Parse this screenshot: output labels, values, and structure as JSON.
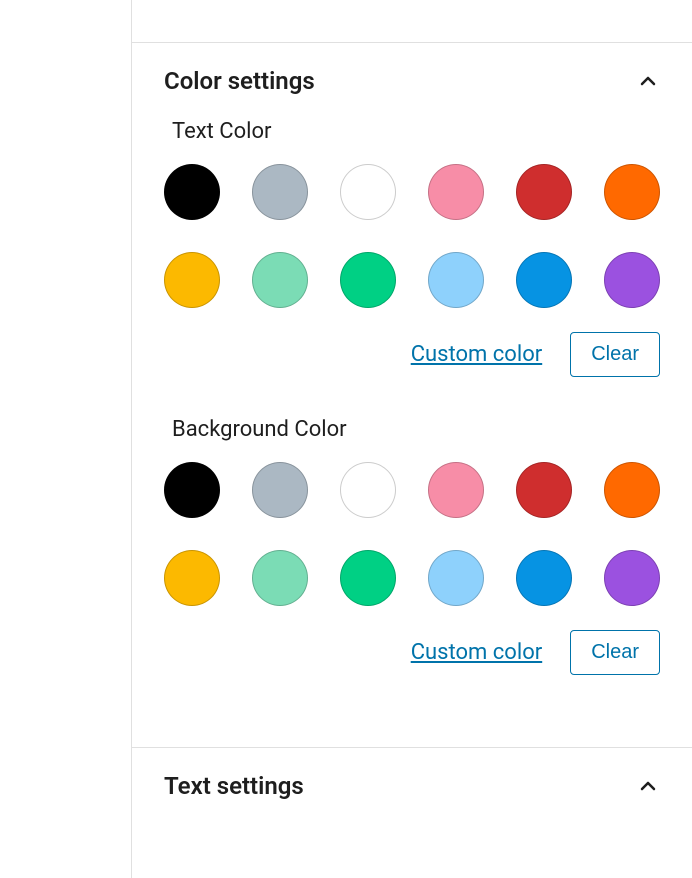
{
  "panels": {
    "colorSettings": {
      "title": "Color settings",
      "textColor": {
        "label": "Text Color",
        "swatches": [
          {
            "name": "black",
            "hex": "#000000"
          },
          {
            "name": "gray",
            "hex": "#abb8c3"
          },
          {
            "name": "white",
            "hex": "#ffffff"
          },
          {
            "name": "pink",
            "hex": "#f78da7"
          },
          {
            "name": "red",
            "hex": "#cf2e2e"
          },
          {
            "name": "orange",
            "hex": "#ff6900"
          },
          {
            "name": "yellow",
            "hex": "#fcb900"
          },
          {
            "name": "light-green",
            "hex": "#7bdcb5"
          },
          {
            "name": "green",
            "hex": "#00d084"
          },
          {
            "name": "light-blue",
            "hex": "#8ed1fc"
          },
          {
            "name": "blue",
            "hex": "#0693e3"
          },
          {
            "name": "purple",
            "hex": "#9b51e0"
          }
        ],
        "customLabel": "Custom color",
        "clearLabel": "Clear"
      },
      "backgroundColor": {
        "label": "Background Color",
        "swatches": [
          {
            "name": "black",
            "hex": "#000000"
          },
          {
            "name": "gray",
            "hex": "#abb8c3"
          },
          {
            "name": "white",
            "hex": "#ffffff"
          },
          {
            "name": "pink",
            "hex": "#f78da7"
          },
          {
            "name": "red",
            "hex": "#cf2e2e"
          },
          {
            "name": "orange",
            "hex": "#ff6900"
          },
          {
            "name": "yellow",
            "hex": "#fcb900"
          },
          {
            "name": "light-green",
            "hex": "#7bdcb5"
          },
          {
            "name": "green",
            "hex": "#00d084"
          },
          {
            "name": "light-blue",
            "hex": "#8ed1fc"
          },
          {
            "name": "blue",
            "hex": "#0693e3"
          },
          {
            "name": "purple",
            "hex": "#9b51e0"
          }
        ],
        "customLabel": "Custom color",
        "clearLabel": "Clear"
      }
    },
    "textSettings": {
      "title": "Text settings"
    }
  }
}
